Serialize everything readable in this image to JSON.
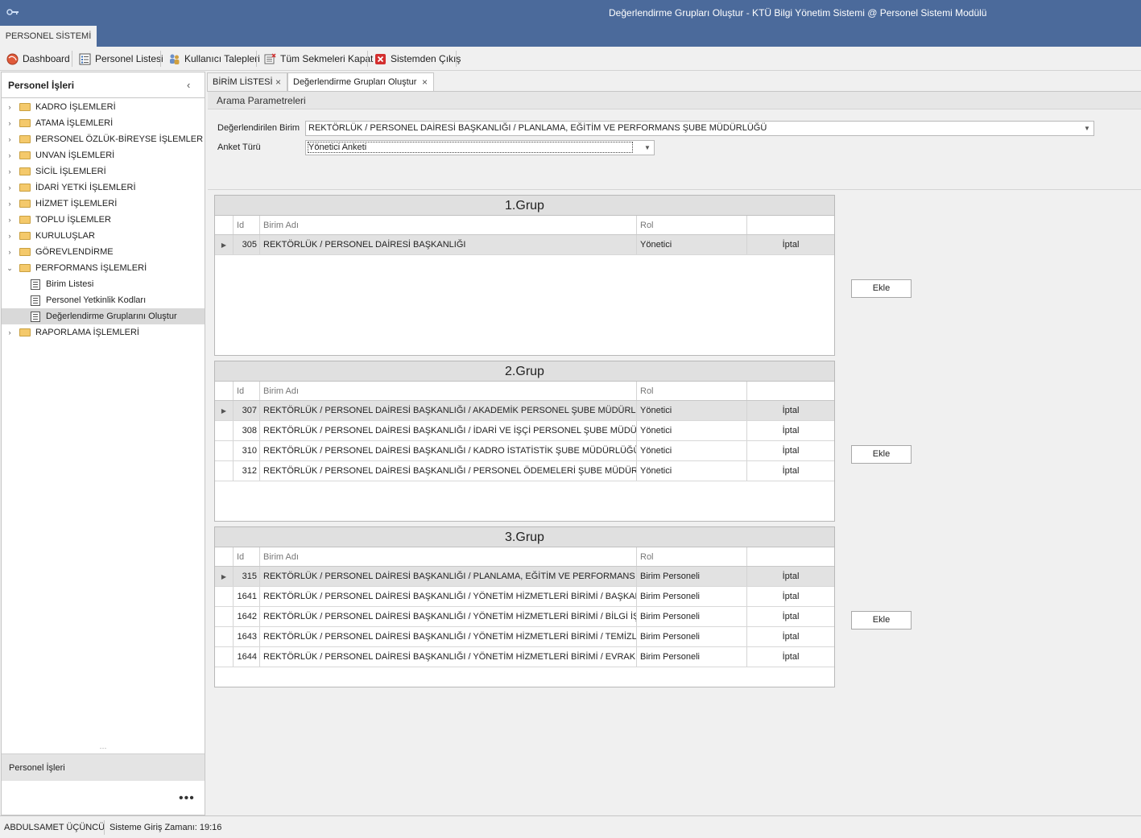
{
  "window": {
    "title": "Değerlendirme Grupları Oluştur - KTÜ Bilgi Yönetim Sistemi @ Personel Sistemi Modülü"
  },
  "ribbon": {
    "tab": "PERSONEL SİSTEMİ"
  },
  "toolbar": {
    "dashboard": "Dashboard",
    "personel_listesi": "Personel Listesi",
    "kullanici_talepleri": "Kullanıcı Talepleri",
    "tum_sekmeleri_kapat": "Tüm Sekmeleri Kapat",
    "sistemden_cikis": "Sistemden Çıkış"
  },
  "sidebar": {
    "title": "Personel İşleri",
    "items": [
      {
        "label": "KADRO İŞLEMLERİ"
      },
      {
        "label": "ATAMA İŞLEMLERİ"
      },
      {
        "label": "PERSONEL ÖZLÜK-BİREYSE İŞLEMLER"
      },
      {
        "label": "UNVAN İŞLEMLERİ"
      },
      {
        "label": "SİCİL İŞLEMLERİ"
      },
      {
        "label": "İDARİ YETKİ İŞLEMLERİ"
      },
      {
        "label": "HİZMET İŞLEMLERİ"
      },
      {
        "label": "TOPLU İŞLEMLER"
      },
      {
        "label": "KURULUŞLAR"
      },
      {
        "label": "GÖREVLENDİRME"
      },
      {
        "label": "PERFORMANS İŞLEMLERİ"
      },
      {
        "label": "Birim Listesi"
      },
      {
        "label": "Personel Yetkinlik Kodları"
      },
      {
        "label": "Değerlendirme Gruplarını Oluştur"
      },
      {
        "label": "RAPORLAMA İŞLEMLERİ"
      }
    ],
    "footer": "Personel İşleri",
    "more": "•••"
  },
  "tabs": [
    {
      "label": "BİRİM LİSTESİ"
    },
    {
      "label": "Değerlendirme Grupları Oluştur"
    }
  ],
  "params": {
    "title": "Arama Parametreleri",
    "birim_label": "Değerlendirilen Birim",
    "birim_value": "REKTÖRLÜK / PERSONEL DAİRESİ BAŞKANLIĞI /  PLANLAMA, EĞİTİM VE PERFORMANS ŞUBE MÜDÜRLÜĞÜ",
    "anket_label": "Anket Türü",
    "anket_value": "Yönetici Anketi"
  },
  "grid_headers": {
    "id": "Id",
    "birim": "Birim Adı",
    "rol": "Rol"
  },
  "groups": [
    {
      "title": "1.Grup",
      "rows": [
        {
          "id": "305",
          "birim": "REKTÖRLÜK /  PERSONEL DAİRESİ BAŞKANLIĞI",
          "rol": "Yönetici",
          "action": "İptal"
        }
      ]
    },
    {
      "title": "2.Grup",
      "rows": [
        {
          "id": "307",
          "birim": "REKTÖRLÜK / PERSONEL DAİRESİ BAŞKANLIĞI /  AKADEMİK PERSONEL ŞUBE MÜDÜRLÜĞÜ",
          "rol": "Yönetici",
          "action": "İptal"
        },
        {
          "id": "308",
          "birim": "REKTÖRLÜK / PERSONEL DAİRESİ BAŞKANLIĞI /  İDARİ VE İŞÇİ PERSONEL ŞUBE MÜDÜRLÜĞÜ",
          "rol": "Yönetici",
          "action": "İptal"
        },
        {
          "id": "310",
          "birim": "REKTÖRLÜK / PERSONEL DAİRESİ BAŞKANLIĞI /  KADRO İSTATİSTİK ŞUBE MÜDÜRLÜĞÜ",
          "rol": "Yönetici",
          "action": "İptal"
        },
        {
          "id": "312",
          "birim": "REKTÖRLÜK / PERSONEL DAİRESİ BAŞKANLIĞI /  PERSONEL ÖDEMELERİ ŞUBE MÜDÜRLÜĞÜ",
          "rol": "Yönetici",
          "action": "İptal"
        }
      ]
    },
    {
      "title": "3.Grup",
      "rows": [
        {
          "id": "315",
          "birim": "REKTÖRLÜK / PERSONEL DAİRESİ BAŞKANLIĞI /  PLANLAMA, EĞİTİM VE PERFORMANS ŞUBE ...",
          "rol": "Birim Personeli",
          "action": "İptal"
        },
        {
          "id": "1641",
          "birim": "REKTÖRLÜK / PERSONEL DAİRESİ BAŞKANLIĞI / YÖNETİM HİZMETLERİ BİRİMİ /  BAŞKAN SEK...",
          "rol": "Birim Personeli",
          "action": "İptal"
        },
        {
          "id": "1642",
          "birim": "REKTÖRLÜK / PERSONEL DAİRESİ BAŞKANLIĞI / YÖNETİM HİZMETLERİ BİRİMİ /  BİLGİ İŞLEM...",
          "rol": "Birim Personeli",
          "action": "İptal"
        },
        {
          "id": "1643",
          "birim": "REKTÖRLÜK / PERSONEL DAİRESİ BAŞKANLIĞI / YÖNETİM HİZMETLERİ BİRİMİ /  TEMİZLİK Bİ...",
          "rol": "Birim Personeli",
          "action": "İptal"
        },
        {
          "id": "1644",
          "birim": "REKTÖRLÜK / PERSONEL DAİRESİ BAŞKANLIĞI / YÖNETİM HİZMETLERİ BİRİMİ /  EVRAK KAYI...",
          "rol": "Birim Personeli",
          "action": "İptal"
        }
      ]
    }
  ],
  "ekle_label": "Ekle",
  "status": {
    "user": "ABDULSAMET ÜÇÜNCÜ",
    "login_time": "Sisteme Giriş Zamanı: 19:16"
  },
  "icons": {
    "app": "key-icon",
    "dashboard": "globe-icon",
    "personel_listesi": "list-icon",
    "kullanici_talepleri": "users-icon",
    "tum_sekmeleri_kapat": "close-tabs-icon",
    "sistemden_cikis": "exit-icon",
    "tree_folder": "folder-icon",
    "tree_leaf": "list-icon"
  },
  "colors": {
    "titlebar": "#4b6a9b",
    "selection": "#e2e2e2",
    "exit_red": "#d32f2f"
  }
}
